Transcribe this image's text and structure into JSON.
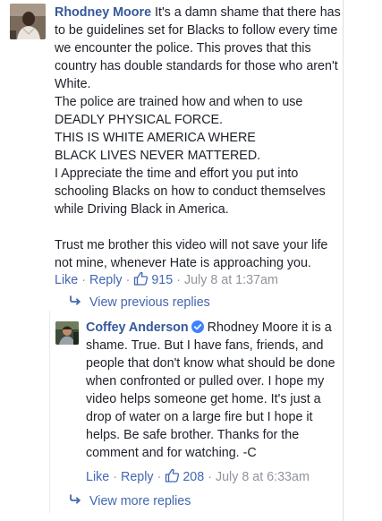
{
  "colors": {
    "link": "#4267b2",
    "author": "#365899",
    "meta": "#90949c",
    "text": "#1d2129",
    "verified_badge": "#4080ff"
  },
  "comment_main": {
    "author": "Rhodney Moore",
    "avatar_icon": "profile-photo",
    "text": " It's a damn shame that there has to be guidelines set for Blacks to follow every time we encounter the police. This proves that this country has double standards for those who aren't White.\nThe police are trained how and when to use DEADLY PHYSICAL FORCE.\nTHIS IS WHITE AMERICA WHERE\nBLACK LIVES NEVER MATTERED.\nI Appreciate the time and effort you put into schooling Blacks on how to conduct themselves while Driving Black in America.\n\nTrust me brother this video will not save your life not mine, whenever Hate is approaching you.",
    "actions": {
      "like": "Like",
      "reply": "Reply",
      "like_icon": "thumbs-up-icon",
      "like_count": "915",
      "timestamp": "July 8 at 1:37am"
    }
  },
  "view_previous": {
    "icon": "reply-arrow-icon",
    "label": "View previous replies"
  },
  "comment_reply": {
    "author": "Coffey Anderson",
    "verified_icon": "verified-badge-icon",
    "avatar_icon": "profile-photo",
    "text": " Rhodney Moore it is a shame. True. But I have fans, friends, and people that don't know what should be done when confronted or pulled over. I hope my video helps someone get home. It's just a drop of water on a large fire but I hope it helps. Be safe brother. Thanks for the comment and for watching. -C",
    "actions": {
      "like": "Like",
      "reply": "Reply",
      "like_icon": "thumbs-up-icon",
      "like_count": "208",
      "timestamp": "July 8 at 6:33am"
    }
  },
  "view_more": {
    "icon": "reply-arrow-icon",
    "label": "View more replies"
  }
}
